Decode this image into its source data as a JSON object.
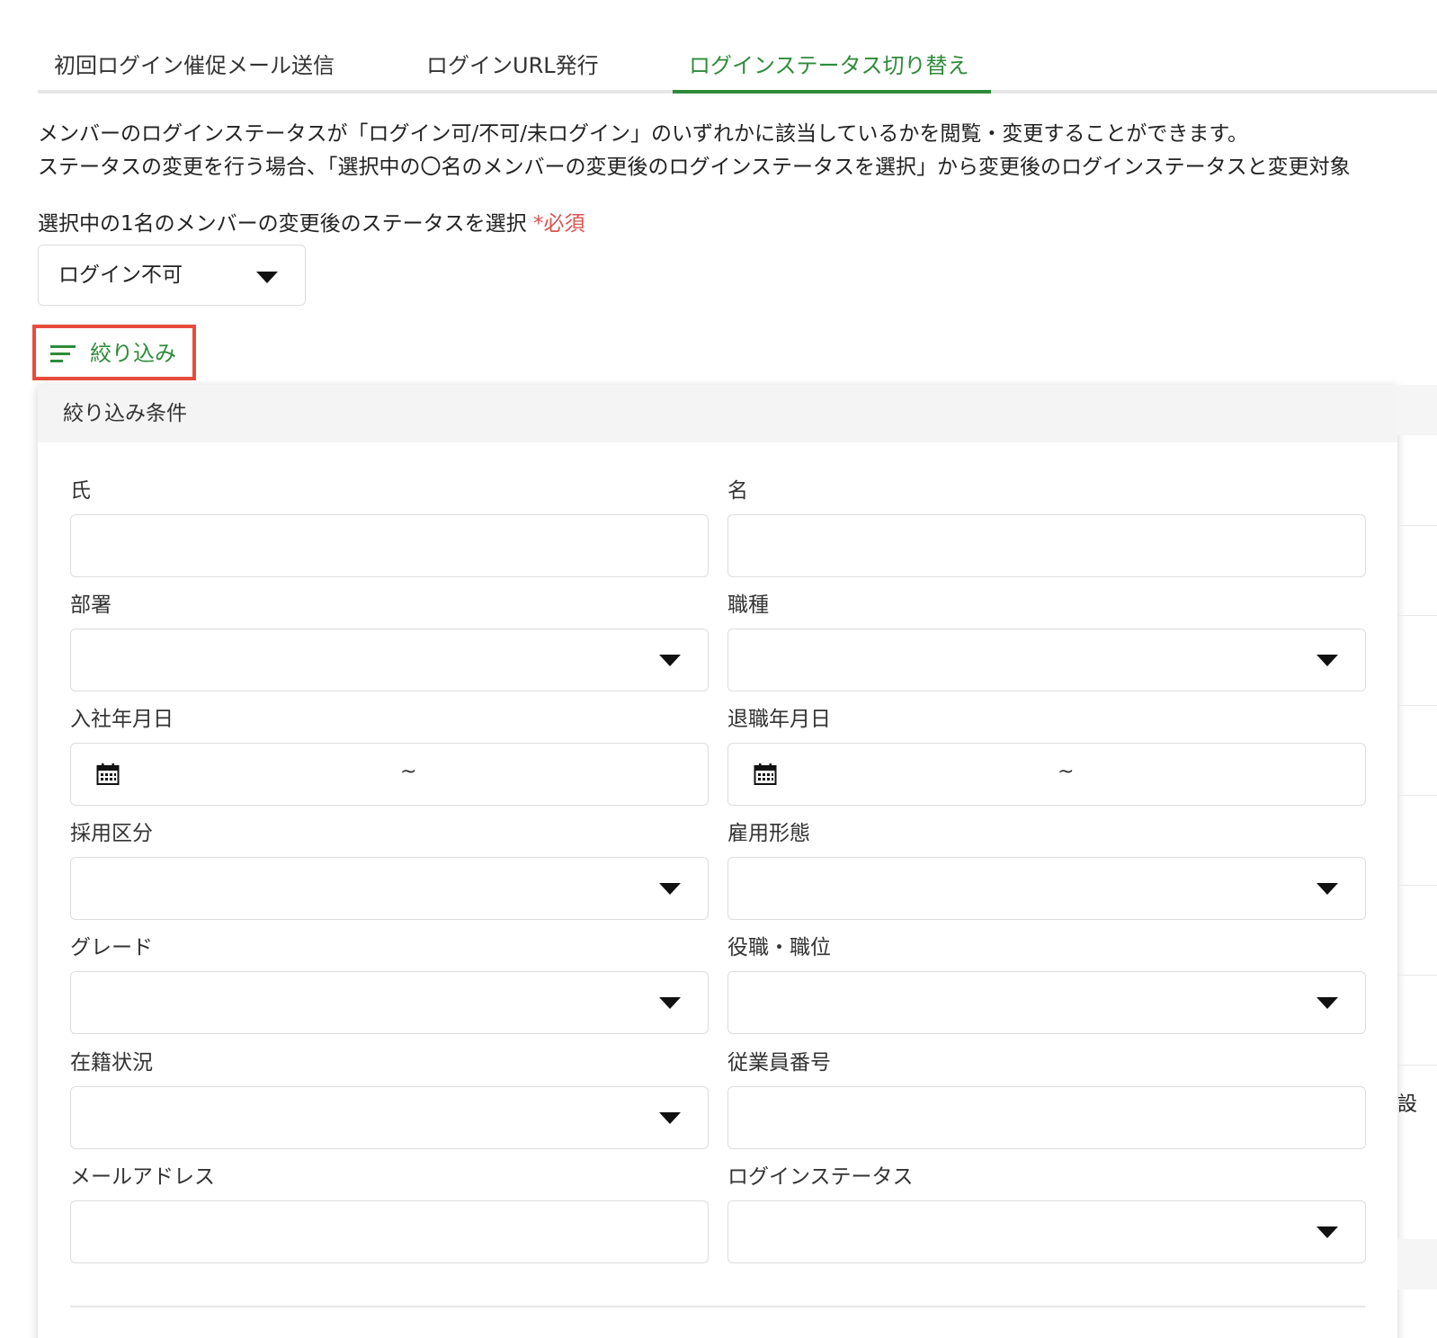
{
  "tabs": [
    {
      "label": "初回ログイン催促メール送信"
    },
    {
      "label": "ログインURL発行"
    },
    {
      "label": "ログインステータス切り替え"
    }
  ],
  "description": {
    "line1": "メンバーのログインステータスが「ログイン可/不可/未ログイン」のいずれかに該当しているかを閲覧・変更することができます。",
    "line2": "ステータスの変更を行う場合、「選択中の〇名のメンバーの変更後のログインステータスを選択」から変更後のログインステータスと変更対象"
  },
  "status_select": {
    "label": "選択中の1名のメンバーの変更後のステータスを選択",
    "required": "*必須",
    "value": "ログイン不可"
  },
  "filter_button": {
    "label": "絞り込み"
  },
  "filter_panel": {
    "title": "絞り込み条件",
    "fields": {
      "last_name": {
        "label": "氏"
      },
      "first_name": {
        "label": "名"
      },
      "department": {
        "label": "部署"
      },
      "job_type": {
        "label": "職種"
      },
      "hire_date": {
        "label": "入社年月日",
        "separator": "~"
      },
      "retire_date": {
        "label": "退職年月日",
        "separator": "~"
      },
      "hiring_type": {
        "label": "採用区分"
      },
      "employment_type": {
        "label": "雇用形態"
      },
      "grade": {
        "label": "グレード"
      },
      "position": {
        "label": "役職・職位"
      },
      "enrollment_status": {
        "label": "在籍状況"
      },
      "employee_number": {
        "label": "従業員番号"
      },
      "email": {
        "label": "メールアドレス"
      },
      "login_status": {
        "label": "ログインステータス"
      }
    }
  },
  "background_glyph": "設",
  "colors": {
    "accent_green": "#2e8b3a",
    "highlight_red": "#e74c3c",
    "required_red": "#d9534f"
  }
}
